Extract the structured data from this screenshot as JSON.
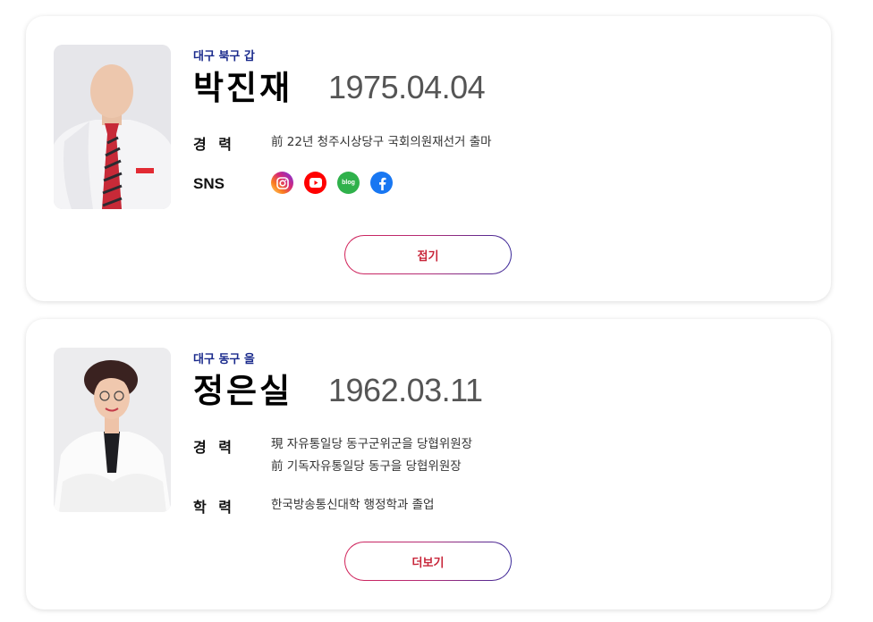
{
  "candidates": [
    {
      "district": "대구 북구 갑",
      "name": "박진재",
      "birth": "1975.04.04",
      "career_label": "경 력",
      "career": [
        "前 22년 청주시상당구 국회의원재선거 출마"
      ],
      "sns_label": "SNS",
      "sns": [
        {
          "icon": "instagram-icon",
          "color": "#d62976"
        },
        {
          "icon": "youtube-icon",
          "color": "#ff0000"
        },
        {
          "icon": "blog-icon",
          "color": "#2db400",
          "text": "blog"
        },
        {
          "icon": "facebook-icon",
          "color": "#1877f2"
        }
      ],
      "button_label": "접기"
    },
    {
      "district": "대구 동구 을",
      "name": "정은실",
      "birth": "1962.03.11",
      "career_label": "경 력",
      "career": [
        "現 자유통일당 동구군위군을 당협위원장",
        "前 기독자유통일당 동구을 당협위원장"
      ],
      "education_label": "학 력",
      "education": "한국방송통신대학 행정학과 졸업",
      "button_label": "더보기"
    }
  ],
  "colors": {
    "district": "#1a2a8c",
    "button_text": "#c8263a"
  }
}
